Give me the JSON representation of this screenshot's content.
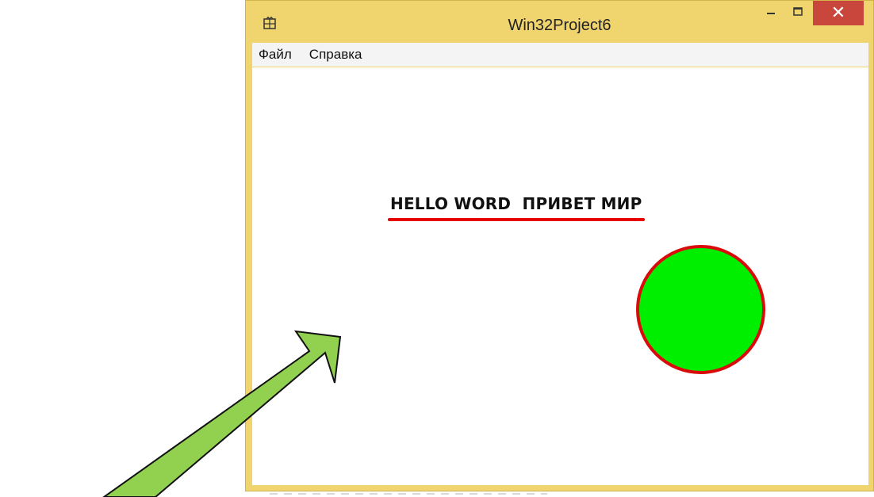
{
  "window": {
    "title": "Win32Project6",
    "close_label": "✕"
  },
  "menu": {
    "items": [
      "Файл",
      "Справка"
    ]
  },
  "canvas": {
    "text": "HELLO WORD  ПРИВЕТ МИР",
    "underline_color": "#e60000",
    "circle_fill": "#00ee00",
    "circle_stroke": "#d90b0b"
  },
  "icons": {
    "app": "app-icon",
    "minimize": "minimize-icon",
    "maximize": "maximize-icon",
    "close": "close-icon",
    "arrow": "pointer-arrow"
  },
  "colors": {
    "frame": "#f0d46e",
    "close_button": "#c9463d",
    "arrow_fill": "#92d050"
  }
}
